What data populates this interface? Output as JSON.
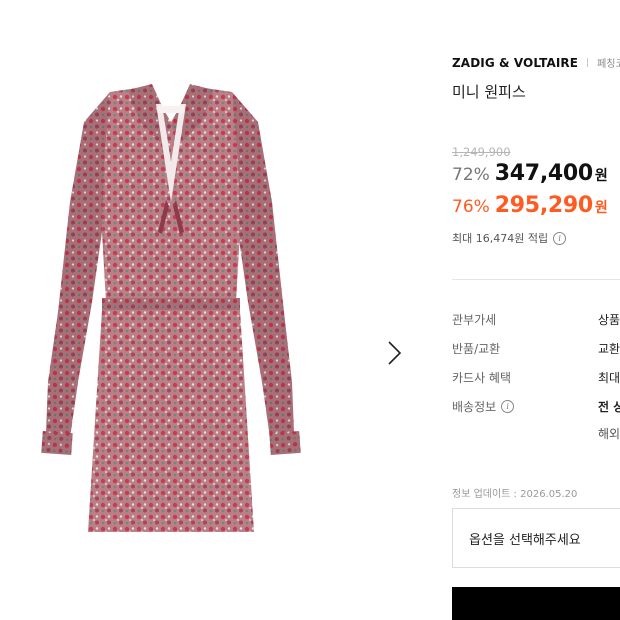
{
  "product": {
    "brand": "ZADIG & VOLTAIRE",
    "category": "페칭코오",
    "name": "미니 원피스",
    "image_alt": "floral print mini dress",
    "image_label": "ZADIG"
  },
  "price": {
    "original": "1,249,900",
    "sale": {
      "percent": "72%",
      "amount": "347,400",
      "unit": "원"
    },
    "coupon": {
      "percent": "76%",
      "amount": "295,290",
      "unit": "원"
    },
    "points": "최대 16,474원 적립"
  },
  "specs": [
    {
      "label": "관부가세",
      "value": "상품"
    },
    {
      "label": "반품/교환",
      "value": "교환"
    },
    {
      "label": "카드사 혜택",
      "value": "최대"
    },
    {
      "label": "배송정보",
      "value": "전 상",
      "sub": "해외"
    }
  ],
  "updated": "정보 업데이트 : 2026.05.20",
  "option_placeholder": "옵션을 선택해주세요",
  "colors": {
    "accent": "#ff5a1f",
    "buy_bar": "#000000",
    "dress_base": "#b97f86",
    "dress_pattern": "#c23a4e"
  },
  "icons": {
    "next": "chevron-right-icon",
    "info": "info-circle-icon"
  }
}
